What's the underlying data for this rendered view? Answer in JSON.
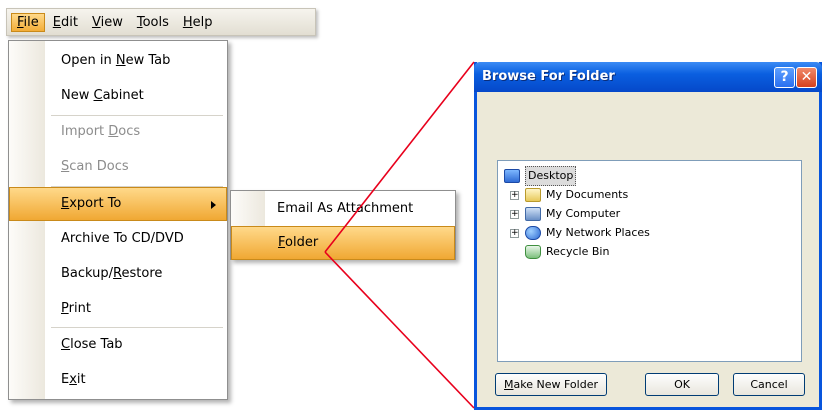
{
  "menubar": {
    "items": [
      {
        "pre": "",
        "key": "F",
        "post": "ile"
      },
      {
        "pre": "",
        "key": "E",
        "post": "dit"
      },
      {
        "pre": "",
        "key": "V",
        "post": "iew"
      },
      {
        "pre": "",
        "key": "T",
        "post": "ools"
      },
      {
        "pre": "",
        "key": "H",
        "post": "elp"
      }
    ]
  },
  "file_menu": {
    "items": [
      {
        "pre": "Open in ",
        "key": "N",
        "post": "ew Tab",
        "state": "normal"
      },
      {
        "pre": "New ",
        "key": "C",
        "post": "abinet",
        "state": "normal"
      },
      {
        "pre": "Import ",
        "key": "D",
        "post": "ocs",
        "state": "disabled"
      },
      {
        "pre": "",
        "key": "S",
        "post": "can Docs",
        "state": "disabled"
      },
      {
        "pre": "",
        "key": "E",
        "post": "xport To",
        "state": "highlighted"
      },
      {
        "pre": "Archive To CD/DVD",
        "key": "",
        "post": "",
        "state": "normal"
      },
      {
        "pre": "Backup/",
        "key": "R",
        "post": "estore",
        "state": "normal"
      },
      {
        "pre": "",
        "key": "P",
        "post": "rint",
        "state": "normal"
      },
      {
        "pre": "",
        "key": "C",
        "post": "lose Tab",
        "state": "normal"
      },
      {
        "pre": "E",
        "key": "x",
        "post": "it",
        "state": "normal"
      }
    ]
  },
  "submenu": {
    "items": [
      {
        "pre": "Email As Attachment",
        "key": "",
        "post": ""
      },
      {
        "pre": "",
        "key": "F",
        "post": "older"
      }
    ]
  },
  "dialog": {
    "title": "Browse For Folder",
    "help_glyph": "?",
    "close_glyph": "✕",
    "tree": [
      {
        "label": "Desktop",
        "icon": "desktop-icon",
        "expander": ""
      },
      {
        "label": "My Documents",
        "icon": "my-documents-icon",
        "expander": "+"
      },
      {
        "label": "My Computer",
        "icon": "my-computer-icon",
        "expander": "+"
      },
      {
        "label": "My Network Places",
        "icon": "network-places-icon",
        "expander": "+"
      },
      {
        "label": "Recycle Bin",
        "icon": "recycle-bin-icon",
        "expander": ""
      }
    ],
    "buttons": {
      "new_folder": {
        "pre": "",
        "key": "M",
        "post": "ake New Folder"
      },
      "ok": "OK",
      "cancel": "Cancel"
    }
  },
  "colors": {
    "highlight": "#f3ad38",
    "title_bar": "#0a5fe0",
    "callout_line": "#e8001c"
  }
}
